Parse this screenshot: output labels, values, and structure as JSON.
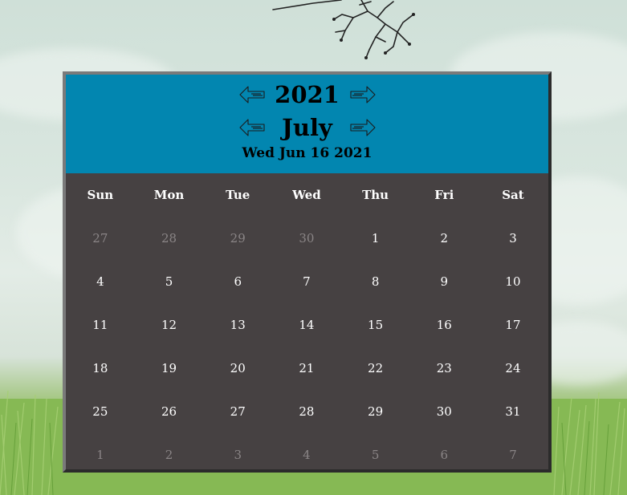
{
  "calendar": {
    "year": "2021",
    "month": "July",
    "today_label": "Wed Jun 16 2021",
    "weekdays": [
      "Sun",
      "Mon",
      "Tue",
      "Wed",
      "Thu",
      "Fri",
      "Sat"
    ],
    "weeks": [
      [
        {
          "d": "27",
          "muted": true
        },
        {
          "d": "28",
          "muted": true
        },
        {
          "d": "29",
          "muted": true
        },
        {
          "d": "30",
          "muted": true
        },
        {
          "d": "1",
          "muted": false
        },
        {
          "d": "2",
          "muted": false
        },
        {
          "d": "3",
          "muted": false
        }
      ],
      [
        {
          "d": "4",
          "muted": false
        },
        {
          "d": "5",
          "muted": false
        },
        {
          "d": "6",
          "muted": false
        },
        {
          "d": "7",
          "muted": false
        },
        {
          "d": "8",
          "muted": false
        },
        {
          "d": "9",
          "muted": false
        },
        {
          "d": "10",
          "muted": false
        }
      ],
      [
        {
          "d": "11",
          "muted": false
        },
        {
          "d": "12",
          "muted": false
        },
        {
          "d": "13",
          "muted": false
        },
        {
          "d": "14",
          "muted": false
        },
        {
          "d": "15",
          "muted": false
        },
        {
          "d": "16",
          "muted": false
        },
        {
          "d": "17",
          "muted": false
        }
      ],
      [
        {
          "d": "18",
          "muted": false
        },
        {
          "d": "19",
          "muted": false
        },
        {
          "d": "20",
          "muted": false
        },
        {
          "d": "21",
          "muted": false
        },
        {
          "d": "22",
          "muted": false
        },
        {
          "d": "23",
          "muted": false
        },
        {
          "d": "24",
          "muted": false
        }
      ],
      [
        {
          "d": "25",
          "muted": false
        },
        {
          "d": "26",
          "muted": false
        },
        {
          "d": "27",
          "muted": false
        },
        {
          "d": "28",
          "muted": false
        },
        {
          "d": "29",
          "muted": false
        },
        {
          "d": "30",
          "muted": false
        },
        {
          "d": "31",
          "muted": false
        }
      ],
      [
        {
          "d": "1",
          "muted": true
        },
        {
          "d": "2",
          "muted": true
        },
        {
          "d": "3",
          "muted": true
        },
        {
          "d": "4",
          "muted": true
        },
        {
          "d": "5",
          "muted": true
        },
        {
          "d": "6",
          "muted": true
        },
        {
          "d": "7",
          "muted": true
        }
      ]
    ],
    "icons": {
      "prev": "left-arrow-icon",
      "next": "right-arrow-icon"
    }
  },
  "colors": {
    "header_bg": "#0286b0",
    "body_bg": "#464142",
    "day_text": "#ffffff",
    "muted_text": "#8a8586"
  }
}
